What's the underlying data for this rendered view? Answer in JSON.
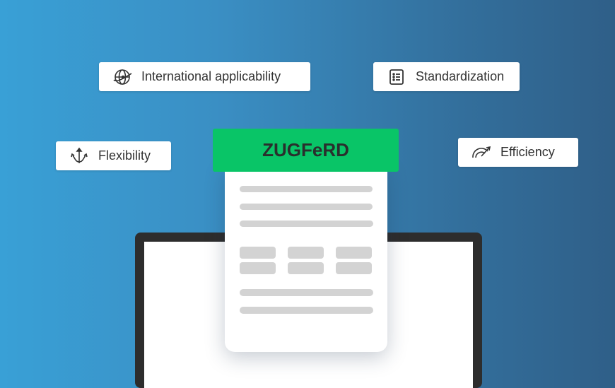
{
  "features": {
    "international": {
      "label": "International applicability",
      "icon": "globe-icon"
    },
    "standardization": {
      "label": "Standardization",
      "icon": "list-icon"
    },
    "flexibility": {
      "label": "Flexibility",
      "icon": "branching-arrows-icon"
    },
    "efficiency": {
      "label": "Efficiency",
      "icon": "speedometer-icon"
    }
  },
  "document": {
    "title": "ZUGFeRD"
  },
  "colors": {
    "banner": "#09c567",
    "bg_left": "#39a0d6",
    "bg_right": "#2f5f88"
  }
}
